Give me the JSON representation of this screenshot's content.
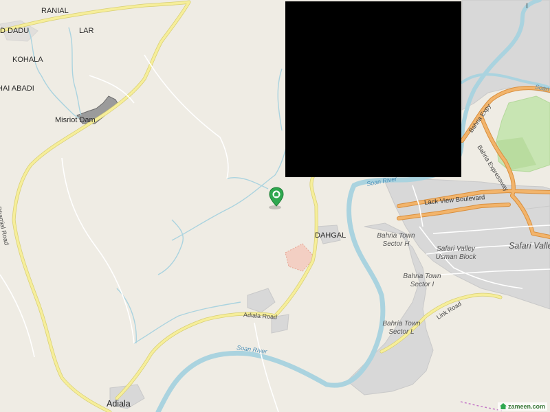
{
  "map": {
    "places": {
      "ranial": "RANIAL",
      "dadu": "D DADU",
      "lar": "LAR",
      "kohala": "KOHALA",
      "abadi": "HAI ABADI",
      "misriot": "Misriot Dam",
      "dahgal": "DAHGAL",
      "adiala": "Adiala",
      "safari": "Safari Valley",
      "edge_i": "I"
    },
    "sectors": {
      "h": "Bahria Town Sector H",
      "i": "Bahria Town Sector I",
      "l": "Bahria Town Sector L",
      "usman": "Safari Valley Usman Block"
    },
    "roads": {
      "dhamial": "Dhamial Road",
      "adiala_road": "Adiala Road",
      "link": "Link Road",
      "lake_view": "Lack View Boulevard",
      "bahria_exp": "Bahria Expy",
      "bahria_expressway": "Bahria Expressway"
    },
    "rivers": {
      "soan_center": "Soan River",
      "soan_mid": "Soan River",
      "soan_top": "Soan"
    },
    "colors": {
      "background": "#efece4",
      "primary_road": "#f6ee9a",
      "major_road": "#f2b46b",
      "water": "#aad3df",
      "park": "#c8e5b3",
      "urban": "#d8d8d8",
      "pin": "#2fa84f",
      "redacted": "#000000"
    },
    "marker_icon": "home-location-pin-icon",
    "attribution": "zameen.com"
  }
}
